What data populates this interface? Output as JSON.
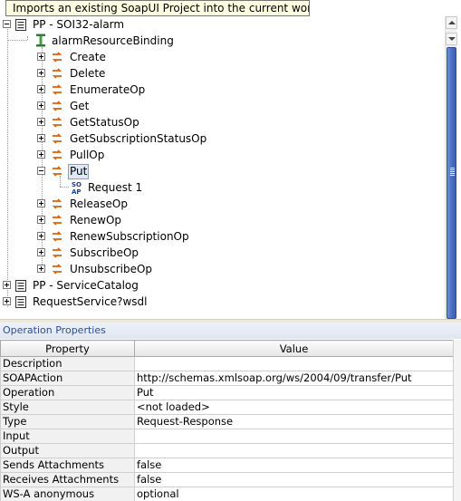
{
  "tooltip": "Imports an existing SoapUI Project into the current workspace",
  "tree": {
    "projects": [
      {
        "label": "PP - SOI32-alarm",
        "expanded": true
      },
      {
        "label": "PP - ServiceCatalog",
        "expanded": false
      },
      {
        "label": "RequestService?wsdl",
        "expanded": false
      }
    ],
    "binding": {
      "label": "alarmResourceBinding"
    },
    "operations": [
      {
        "label": "Create",
        "expanded": false
      },
      {
        "label": "Delete",
        "expanded": false
      },
      {
        "label": "EnumerateOp",
        "expanded": false
      },
      {
        "label": "Get",
        "expanded": false
      },
      {
        "label": "GetStatusOp",
        "expanded": false
      },
      {
        "label": "GetSubscriptionStatusOp",
        "expanded": false
      },
      {
        "label": "PullOp",
        "expanded": false
      },
      {
        "label": "Put",
        "expanded": true,
        "selected": true
      },
      {
        "label": "ReleaseOp",
        "expanded": false
      },
      {
        "label": "RenewOp",
        "expanded": false
      },
      {
        "label": "RenewSubscriptionOp",
        "expanded": false
      },
      {
        "label": "SubscribeOp",
        "expanded": false
      },
      {
        "label": "UnsubscribeOp",
        "expanded": false
      }
    ],
    "request": {
      "label": "Request 1"
    }
  },
  "properties": {
    "title": "Operation Properties",
    "columns": [
      "Property",
      "Value"
    ],
    "rows": [
      {
        "property": "Description",
        "value": ""
      },
      {
        "property": "SOAPAction",
        "value": "http://schemas.xmlsoap.org/ws/2004/09/transfer/Put"
      },
      {
        "property": "Operation",
        "value": "Put"
      },
      {
        "property": "Style",
        "value": "<not loaded>"
      },
      {
        "property": "Type",
        "value": "Request-Response"
      },
      {
        "property": "Input",
        "value": ""
      },
      {
        "property": "Output",
        "value": ""
      },
      {
        "property": "Sends Attachments",
        "value": "false"
      },
      {
        "property": "Receives Attachments",
        "value": "false"
      },
      {
        "property": "WS-A anonymous",
        "value": "optional"
      }
    ]
  },
  "colors": {
    "accent": "#2e4f88",
    "scroll_thumb": "#4a6fc4",
    "selection": "#dde8f8",
    "tooltip_bg": "#ffffe1"
  }
}
